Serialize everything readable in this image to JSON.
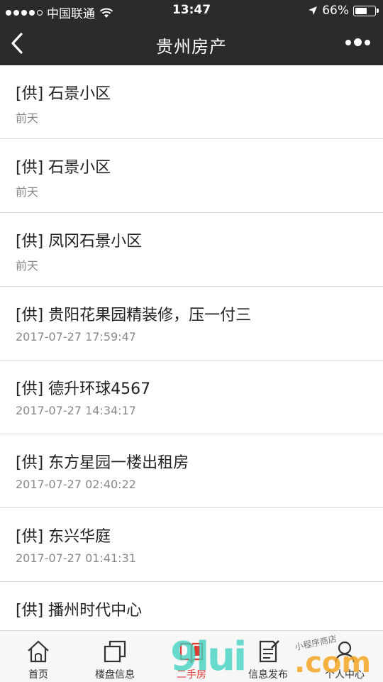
{
  "status_bar": {
    "carrier": "中国联通",
    "time": "13:47",
    "battery": "66%",
    "battery_level": 0.66
  },
  "nav": {
    "title": "贵州房产"
  },
  "list": [
    {
      "title": "[供] 石景小区",
      "time": "前天"
    },
    {
      "title": "[供] 石景小区",
      "time": "前天"
    },
    {
      "title": "[供] 凤冈石景小区",
      "time": "前天"
    },
    {
      "title": "[供] 贵阳花果园精装修，压一付三",
      "time": "2017-07-27 17:59:47"
    },
    {
      "title": "[供] 德升环球4567",
      "time": "2017-07-27 14:34:17"
    },
    {
      "title": "[供] 东方星园一楼出租房",
      "time": "2017-07-27 02:40:22"
    },
    {
      "title": "[供] 东兴华庭",
      "time": "2017-07-27 01:41:31"
    },
    {
      "title": "[供] 播州时代中心",
      "time": ""
    }
  ],
  "tabs": [
    {
      "label": "首页",
      "icon": "home-icon"
    },
    {
      "label": "楼盘信息",
      "icon": "buildings-icon"
    },
    {
      "label": "二手房",
      "icon": "book-icon"
    },
    {
      "label": "信息发布",
      "icon": "edit-document-icon"
    },
    {
      "label": "个人中心",
      "icon": "user-icon"
    }
  ],
  "watermark": {
    "main": "9lui",
    "com": ".com",
    "small": "小程序商店"
  },
  "colors": {
    "header_bg": "#2b2b2b",
    "active_tab": "#e0382f",
    "divider": "#dcdcdc"
  }
}
